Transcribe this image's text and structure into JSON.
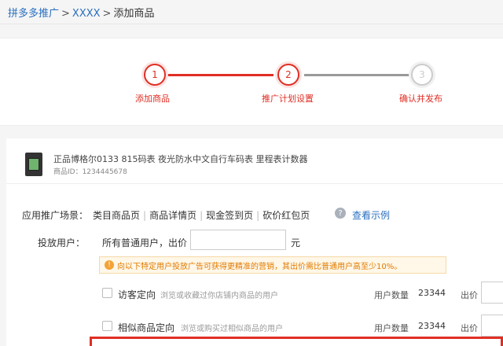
{
  "breadcrumb": {
    "item1": "拼多多推广",
    "sep1": ">",
    "item2": "XXXX",
    "sep2": ">",
    "item3": "添加商品"
  },
  "steps": [
    {
      "number": "1",
      "label": "添加商品"
    },
    {
      "number": "2",
      "label": "推广计划设置"
    },
    {
      "number": "3",
      "label": "确认并发布"
    }
  ],
  "product": {
    "name": "正品博格尔0133 815码表 夜光防水中文自行车码表 里程表计数器",
    "id": "商品ID：1234445678"
  },
  "scenes": {
    "label": "应用推广场景：",
    "tabs": [
      "类目商品页",
      "商品详情页",
      "现金签到页",
      "砍价红包页"
    ],
    "separator": "|",
    "help_icon": "?",
    "view_example": "查看示例"
  },
  "bid": {
    "label": "投放用户：",
    "text": "所有普通用户，出价",
    "input_value": "",
    "unit": "元"
  },
  "notice": {
    "icon": "!",
    "text": "向以下特定用户投放广告可获得更精准的营销，其出价需比普通用户高至少10%。"
  },
  "targeting": [
    {
      "name": "访客定向",
      "desc": "浏览或收藏过你店铺内商品的用户",
      "users_label": "用户数量",
      "users_value": "23344",
      "bid_label": "出价"
    },
    {
      "name": "相似商品定向",
      "desc": "浏览或购买过相似商品的用户",
      "users_label": "用户数量",
      "users_value": "23344",
      "bid_label": "出价"
    }
  ],
  "colors": {
    "accent": "#e02e24",
    "link": "#2a6fbf",
    "notice_text": "#e07b00"
  }
}
